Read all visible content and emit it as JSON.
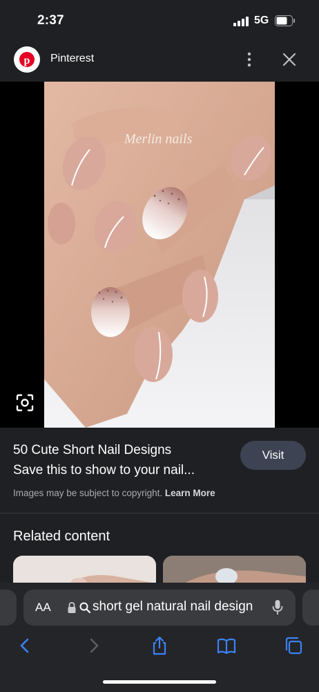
{
  "status": {
    "time": "2:37",
    "network": "5G"
  },
  "header": {
    "site_name": "Pinterest"
  },
  "image": {
    "watermark": "Merlin nails"
  },
  "pin": {
    "title_line1": "50 Cute Short Nail Designs",
    "title_line2": "Save this to show to your nail...",
    "visit_label": "Visit",
    "copyright_text": "Images may be subject to copyright.",
    "learn_more": "Learn More"
  },
  "related": {
    "heading": "Related content"
  },
  "browser": {
    "aa_label": "AA",
    "url_text": "short gel natural nail design"
  },
  "colors": {
    "background": "#1f2023",
    "visit_button": "#3d4352",
    "accent_blue": "#3b82f6"
  }
}
